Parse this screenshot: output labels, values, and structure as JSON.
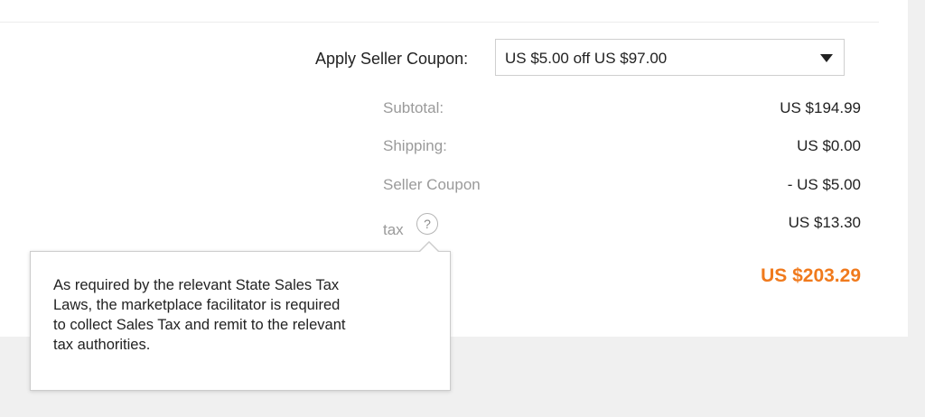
{
  "coupon": {
    "label": "Apply Seller Coupon:",
    "selected": "US $5.00 off US $97.00",
    "caret_icon": "caret-down-icon"
  },
  "summary": {
    "subtotal": {
      "label": "Subtotal:",
      "value": "US $194.99"
    },
    "shipping": {
      "label": "Shipping:",
      "value": "US $0.00"
    },
    "seller_coupon": {
      "label": "Seller Coupon",
      "value": "- US $5.00"
    },
    "tax": {
      "label": "tax",
      "help_icon": "?",
      "value": "US $13.30"
    },
    "total": {
      "value": "US $203.29"
    }
  },
  "tooltip": {
    "line1": "As required by the relevant State Sales Tax",
    "line2": "Laws, the marketplace facilitator is required",
    "line3": "to collect Sales Tax and remit to the relevant",
    "line4": "tax authorities."
  },
  "colors": {
    "total": "#f07a1d",
    "label_gray": "#9a9a9a",
    "text": "#222222",
    "background": "#f0f0f0",
    "card": "#ffffff"
  }
}
